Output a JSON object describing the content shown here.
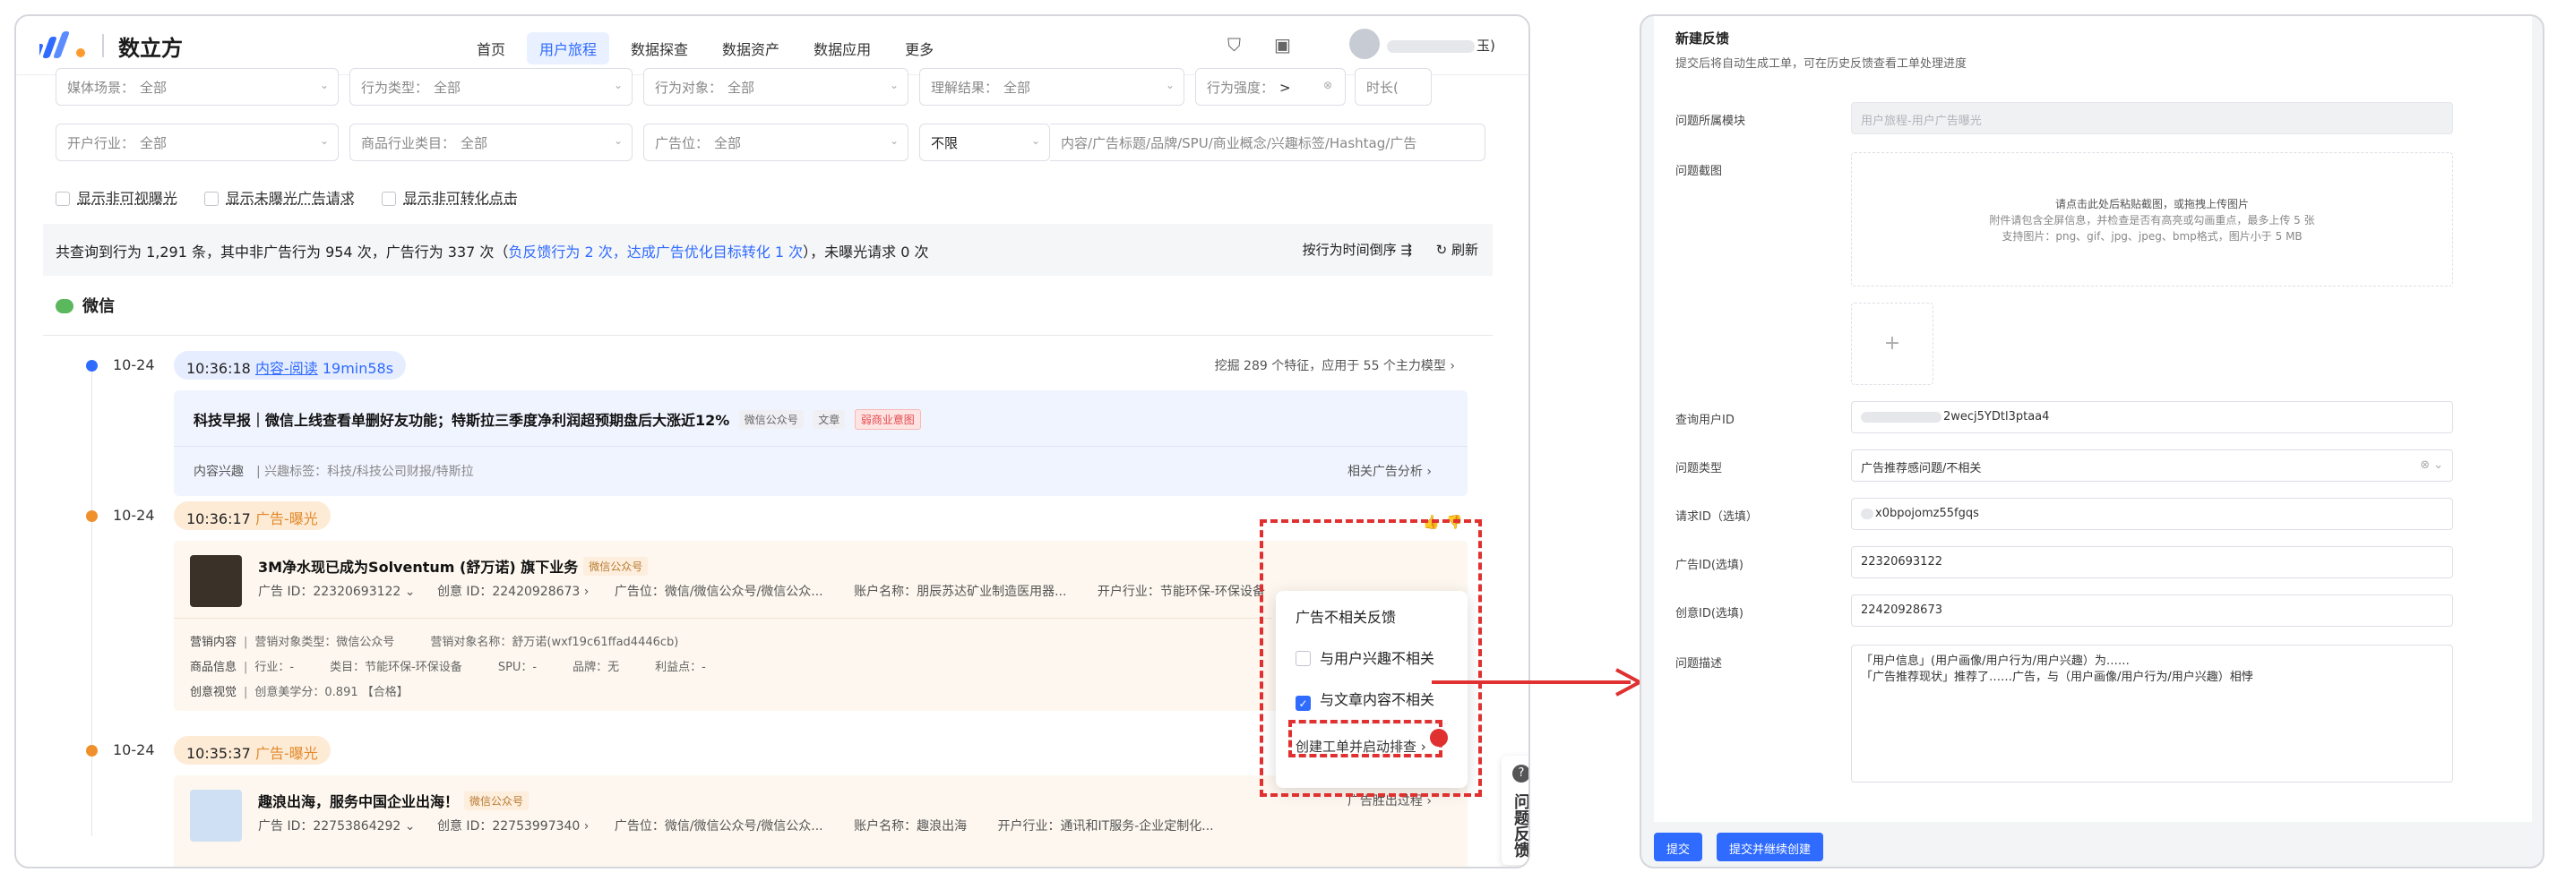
{
  "header": {
    "app_name": "数立方",
    "nav": [
      "首页",
      "用户旅程",
      "数据探查",
      "数据资产",
      "数据应用",
      "更多"
    ],
    "active_nav": "用户旅程",
    "user_name_suffix": "玉)"
  },
  "filters": {
    "row1": [
      {
        "label": "媒体场景：",
        "value": "全部"
      },
      {
        "label": "行为类型：",
        "value": "全部"
      },
      {
        "label": "行为对象：",
        "value": "全部"
      },
      {
        "label": "理解结果：",
        "value": "全部"
      },
      {
        "label": "行为强度：",
        "value": ">"
      }
    ],
    "row1_extra": "时长(",
    "row2": [
      {
        "label": "开户行业：",
        "value": "全部"
      },
      {
        "label": "商品行业类目：",
        "value": "全部"
      },
      {
        "label": "广告位：",
        "value": "全部"
      }
    ],
    "limit": "不限",
    "search_placeholder": "内容/广告标题/品牌/SPU/商业概念/兴趣标签/Hashtag/广告"
  },
  "checkboxes": [
    "显示非可视曝光",
    "显示未曝光广告请求",
    "显示非可转化点击"
  ],
  "summary": {
    "prefix": "共查询到行为 1,291 条，其中非广告行为 954 次，广告行为 337 次（",
    "link": "负反馈行为 2 次，达成广告优化目标转化 1 次",
    "suffix": "），未曝光请求 0 次",
    "sort": "按行为时间倒序",
    "refresh": "刷新"
  },
  "section": "微信",
  "events": [
    {
      "date": "10-24",
      "time": "10:36:18",
      "kind": "内容-阅读",
      "extra": "19min58s",
      "right": "挖掘 289 个特征，应用于 55 个主力模型",
      "title": "科技早报｜微信上线查看单删好友功能；特斯拉三季度净利润超预期盘后大涨近12%",
      "tags": [
        "微信公众号",
        "文章",
        "弱商业意图"
      ],
      "interest": "内容兴趣",
      "interest_tags": "兴趣标签：科技/科技公司财报/特斯拉",
      "related": "相关广告分析"
    },
    {
      "date": "10-24",
      "time": "10:36:17",
      "kind": "广告-曝光",
      "title": "3M净水现已成为Solventum (舒万诺) 旗下业务",
      "tag": "微信公众号",
      "ad_id": "广告 ID：22320693122",
      "creative_id": "创意 ID：22420928673",
      "placement": "广告位：微信/微信公众号/微信公众...",
      "account": "账户名称：朋辰苏达矿业制造医用器...",
      "industry": "开户行业：节能环保-环保设备",
      "rows": [
        {
          "k": "营销内容",
          "v": "营销对象类型：微信公众号",
          "v2": "营销对象名称：舒万诺(wxf19c61ffad4446cb)"
        },
        {
          "k": "商品信息",
          "v": "行业：-",
          "v2": "类目：节能环保-环保设备",
          "v3": "SPU：-",
          "v4": "品牌：无",
          "v5": "利益点：-"
        },
        {
          "k": "创意视觉",
          "v": "创意美学分：0.891 【合格】"
        }
      ]
    },
    {
      "date": "10-24",
      "time": "10:35:37",
      "kind": "广告-曝光",
      "title": "趣浪出海，服务中国企业出海！",
      "tag": "微信公众号",
      "ad_id": "广告 ID：22753864292",
      "creative_id": "创意 ID：22753997340",
      "placement": "广告位：微信/微信公众号/微信公众...",
      "account": "账户名称：趣浪出海",
      "industry": "开户行业：通讯和IT服务-企业定制化...",
      "right": "广告胜出过程"
    }
  ],
  "popover": {
    "title": "广告不相关反馈",
    "options": [
      {
        "label": "与用户兴趣不相关",
        "checked": false
      },
      {
        "label": "与文章内容不相关",
        "checked": true
      }
    ],
    "create": "创建工单并启动排查"
  },
  "side_feedback": "问题反馈",
  "form": {
    "title": "新建反馈",
    "subtitle": "提交后将自动生成工单，可在历史反馈查看工单处理进度",
    "fields": [
      {
        "label": "问题所属模块",
        "value": "用户旅程-用户广告曝光",
        "disabled": true
      },
      {
        "label": "问题截图"
      },
      {
        "label": "查询用户ID",
        "value": "2wecj5YDtl3ptaa4"
      },
      {
        "label": "问题类型",
        "value": "广告推荐感问题/不相关"
      },
      {
        "label": "请求ID（选填）",
        "value": "x0bpojomz55fgqs"
      },
      {
        "label": "广告ID(选填)",
        "value": "22320693122"
      },
      {
        "label": "创意ID(选填)",
        "value": "22420928673"
      },
      {
        "label": "问题描述",
        "line1": "「用户信息」(用户画像/用户行为/用户兴趣）为……",
        "line2": "「广告推荐现状」推荐了……广告，与（用户画像/用户行为/用户兴趣）相悖"
      }
    ],
    "upload_lines": [
      "请点击此处后粘贴截图，或拖拽上传图片",
      "附件请包含全屏信息，并检查是否有高亮或勾画重点，最多上传 5 张",
      "支持图片：png、gif、jpg、jpeg、bmp格式，图片小于 5 MB"
    ],
    "submit": "提交",
    "submit_continue": "提交并继续创建"
  },
  "colors": {
    "accent": "#2f6bff",
    "annotation": "#e03030",
    "orange": "#e28a2b"
  }
}
